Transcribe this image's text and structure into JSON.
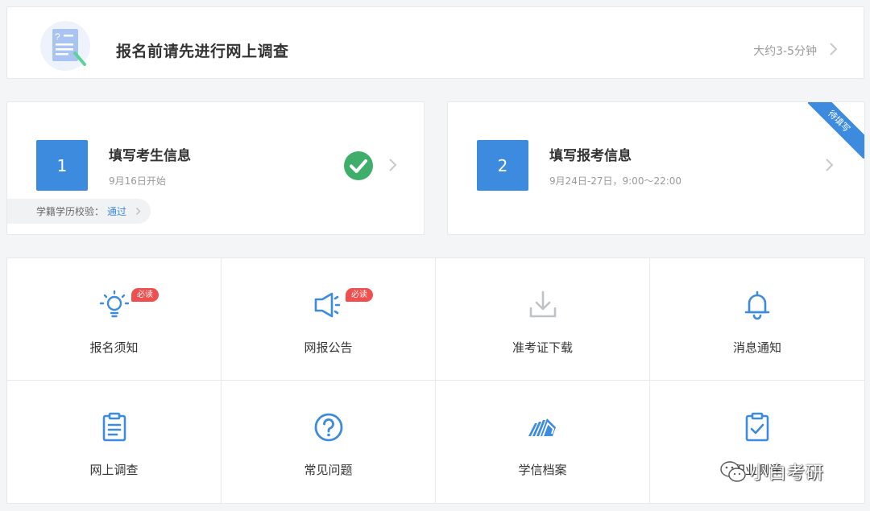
{
  "survey": {
    "title": "报名前请先进行网上调查",
    "time": "大约3-5分钟"
  },
  "steps": [
    {
      "number": "1",
      "title": "填写考生信息",
      "subtitle": "9月16日开始",
      "status": "completed",
      "verify_label": "学籍学历校验：",
      "verify_link": "通过"
    },
    {
      "number": "2",
      "title": "填写报考信息",
      "subtitle": "9月24日-27日，9:00～22:00",
      "ribbon": "待填写"
    }
  ],
  "grid": [
    {
      "label": "报名须知",
      "icon": "lightbulb-icon",
      "badge": "必读"
    },
    {
      "label": "网报公告",
      "icon": "speaker-icon",
      "badge": "必读"
    },
    {
      "label": "准考证下载",
      "icon": "download-icon",
      "disabled": true
    },
    {
      "label": "消息通知",
      "icon": "bell-icon"
    },
    {
      "label": "网上调查",
      "icon": "clipboard-list-icon"
    },
    {
      "label": "常见问题",
      "icon": "question-circle-icon"
    },
    {
      "label": "学信档案",
      "icon": "chsi-archive-icon"
    },
    {
      "label": "职业测评",
      "icon": "clipboard-check-icon"
    }
  ],
  "watermark": {
    "text": "小白考研",
    "icon": "wechat-icon"
  },
  "colors": {
    "accent": "#3c8bdf",
    "success": "#3fae6b",
    "badge": "#f04f4f",
    "disabled": "#bfc3c8"
  }
}
